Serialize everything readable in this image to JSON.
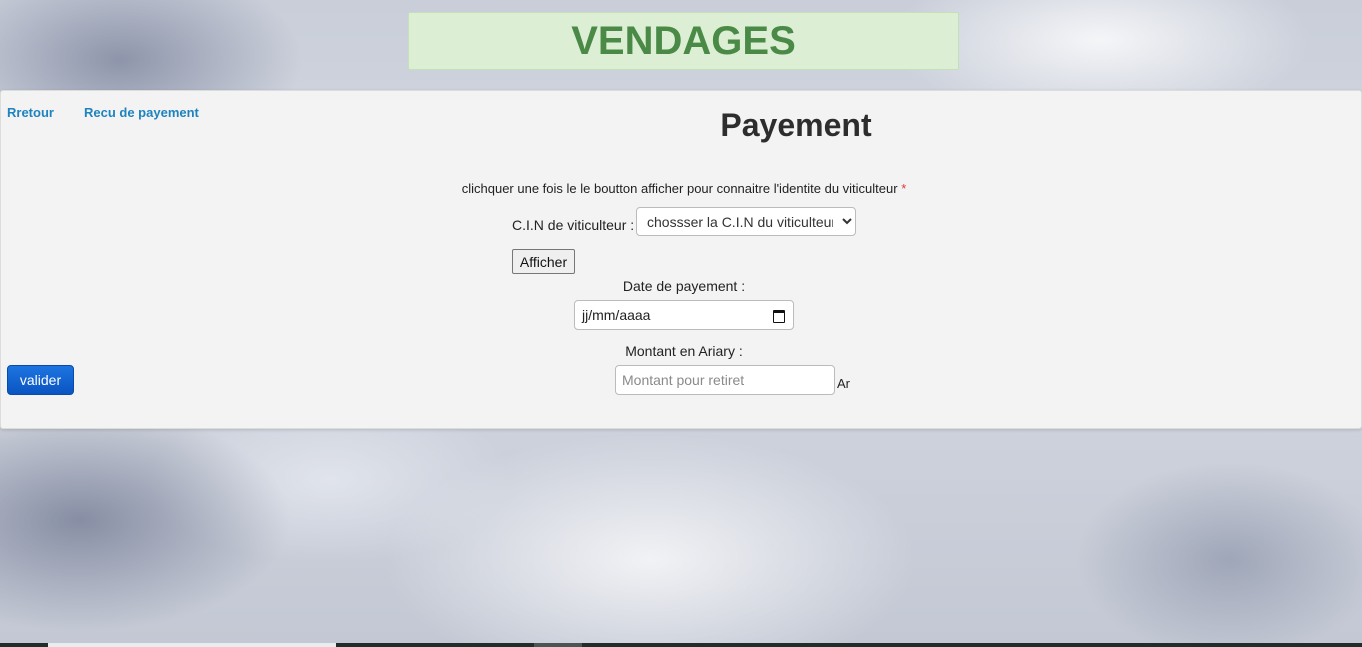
{
  "brand": {
    "title": "VENDAGES"
  },
  "nav": {
    "back_label": "Rretour",
    "receipt_label": "Recu de payement"
  },
  "page": {
    "title": "Payement"
  },
  "form": {
    "instruction": "clichquer une fois le le boutton afficher pour connaitre l'identite du viticulteur",
    "required_mark": "*",
    "cin_label": "C.I.N de viticulteur :",
    "cin_select_value": "chossser la C.I.N du viticulteur",
    "afficher_label": "Afficher",
    "date_label": "Date de payement :",
    "date_placeholder": "jj/mm/aaaa",
    "date_icon": "calendar-icon",
    "montant_label": "Montant en Ariary :",
    "montant_placeholder": "Montant pour retiret",
    "montant_unit": "Ar",
    "valider_label": "valider"
  },
  "colors": {
    "brand_text": "#4a8a46",
    "brand_bg": "#dcefd5",
    "link": "#1e83bf",
    "required": "#e0393a",
    "primary_button": "#0a55c2"
  }
}
